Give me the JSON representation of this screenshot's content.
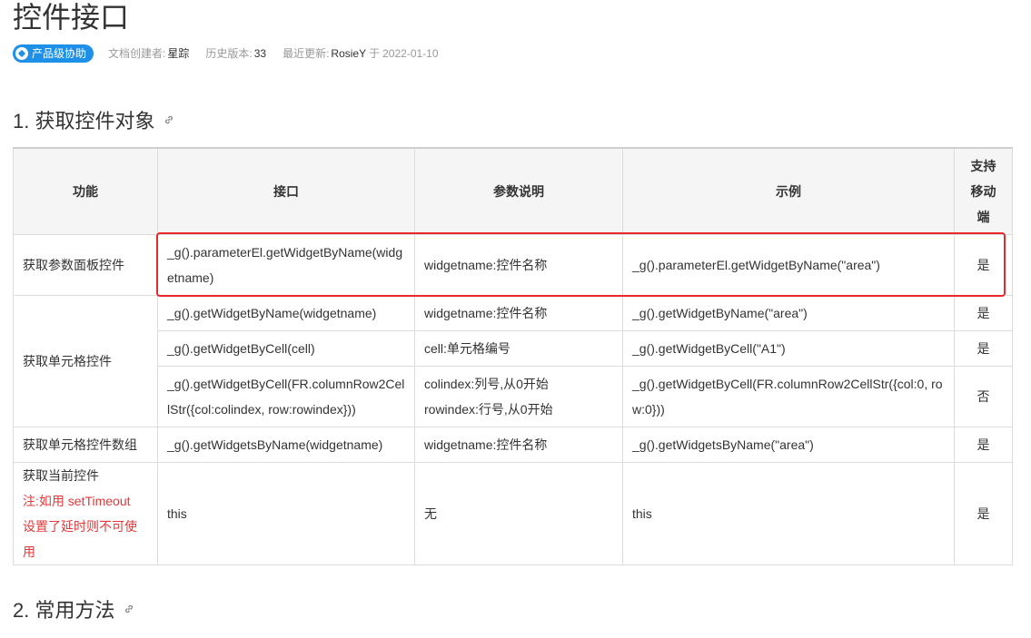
{
  "page": {
    "title": "控件接口"
  },
  "meta": {
    "badge": "产品级协助",
    "creator_label": "文档创建者:",
    "creator": "星踪",
    "history_label": "历史版本:",
    "history": "33",
    "updated_label": "最近更新:",
    "updated_by": "RosieY",
    "updated_sep": "于",
    "updated_date": "2022-01-10"
  },
  "section1": {
    "title": "1. 获取控件对象"
  },
  "section2": {
    "title": "2. 常用方法"
  },
  "table": {
    "headers": [
      "功能",
      "接口",
      "参数说明",
      "示例",
      "支持移动端"
    ],
    "rows": [
      {
        "func": "获取参数面板控件",
        "api": "_g().parameterEl.getWidgetByName(widgetname)",
        "params": "widgetname:控件名称",
        "example": "_g().parameterEl.getWidgetByName(\"area\")",
        "mobile": "是"
      },
      {
        "func": "获取单元格控件",
        "api": "_g().getWidgetByName(widgetname)",
        "params": "widgetname:控件名称",
        "example": "_g().getWidgetByName(\"area\")",
        "mobile": "是"
      },
      {
        "api": "_g().getWidgetByCell(cell)",
        "params": "cell:单元格编号",
        "example": "_g().getWidgetByCell(\"A1\")",
        "mobile": "是"
      },
      {
        "api": "_g().getWidgetByCell(FR.columnRow2CellStr({col:colindex, row:rowindex}))",
        "params_1": "colindex:列号,从0开始",
        "params_2": "rowindex:行号,从0开始",
        "example": "_g().getWidgetByCell(FR.columnRow2CellStr({col:0, row:0}))",
        "mobile": "否"
      },
      {
        "func": "获取单元格控件数组",
        "api": "_g().getWidgetsByName(widgetname)",
        "params": "widgetname:控件名称",
        "example": "_g().getWidgetsByName(\"area\")",
        "mobile": "是"
      },
      {
        "func": "获取当前控件",
        "note_1": "注:如用 setTimeout",
        "note_2": "设置了延时则不可使用",
        "api": "this",
        "params": "无",
        "example": "this",
        "mobile": "是"
      }
    ]
  },
  "icons": {
    "badge": "product-cube-icon",
    "anchor": "link-icon"
  },
  "colors": {
    "badge": "#1e90e8",
    "note": "#e03a3a",
    "highlight": "#e8282b"
  }
}
